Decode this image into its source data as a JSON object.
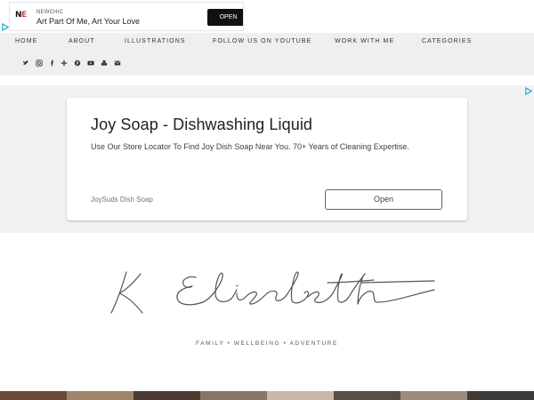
{
  "top_ad": {
    "logo_text": "N",
    "logo_accent": "E",
    "advertiser": "NEWCHIC",
    "headline": "Art Part Of Me, Art Your Love",
    "cta": "OPEN"
  },
  "nav": {
    "items": [
      "HOME",
      "ABOUT",
      "ILLUSTRATIONS",
      "FOLLOW US ON YOUTUBE",
      "WORK WITH ME",
      "CATEGORIES"
    ],
    "social_icons": [
      {
        "name": "twitter-icon",
        "glyph": "🐦"
      },
      {
        "name": "instagram-icon",
        "glyph": "◎"
      },
      {
        "name": "facebook-icon",
        "glyph": "f"
      },
      {
        "name": "bloglovin-icon",
        "glyph": "+"
      },
      {
        "name": "pinterest-icon",
        "glyph": "℗"
      },
      {
        "name": "youtube-icon",
        "glyph": "▶"
      },
      {
        "name": "stumbleupon-icon",
        "glyph": "ஃ"
      },
      {
        "name": "email-icon",
        "glyph": "✉"
      }
    ]
  },
  "ad": {
    "title": "Joy Soap - Dishwashing Liquid",
    "description": "Use Our Store Locator To Find Joy Dish Soap Near You. 70+ Years of Cleaning Expertise.",
    "advertiser": "JoySuds Dish Soap",
    "cta": "Open"
  },
  "site": {
    "tagline": "FAMILY • WELLBEING • ADVENTURE"
  },
  "colors": {
    "nav_bg": "#efefef",
    "ad_band_bg": "#f1f1f1",
    "ad_choices": "#00aecd"
  },
  "photo_strip": [
    "#6b4a3a",
    "#a0856a",
    "#4b3b33",
    "#8a7463",
    "#c9b9a8",
    "#5a4e44",
    "#9b8c7f",
    "#3e3a38"
  ]
}
